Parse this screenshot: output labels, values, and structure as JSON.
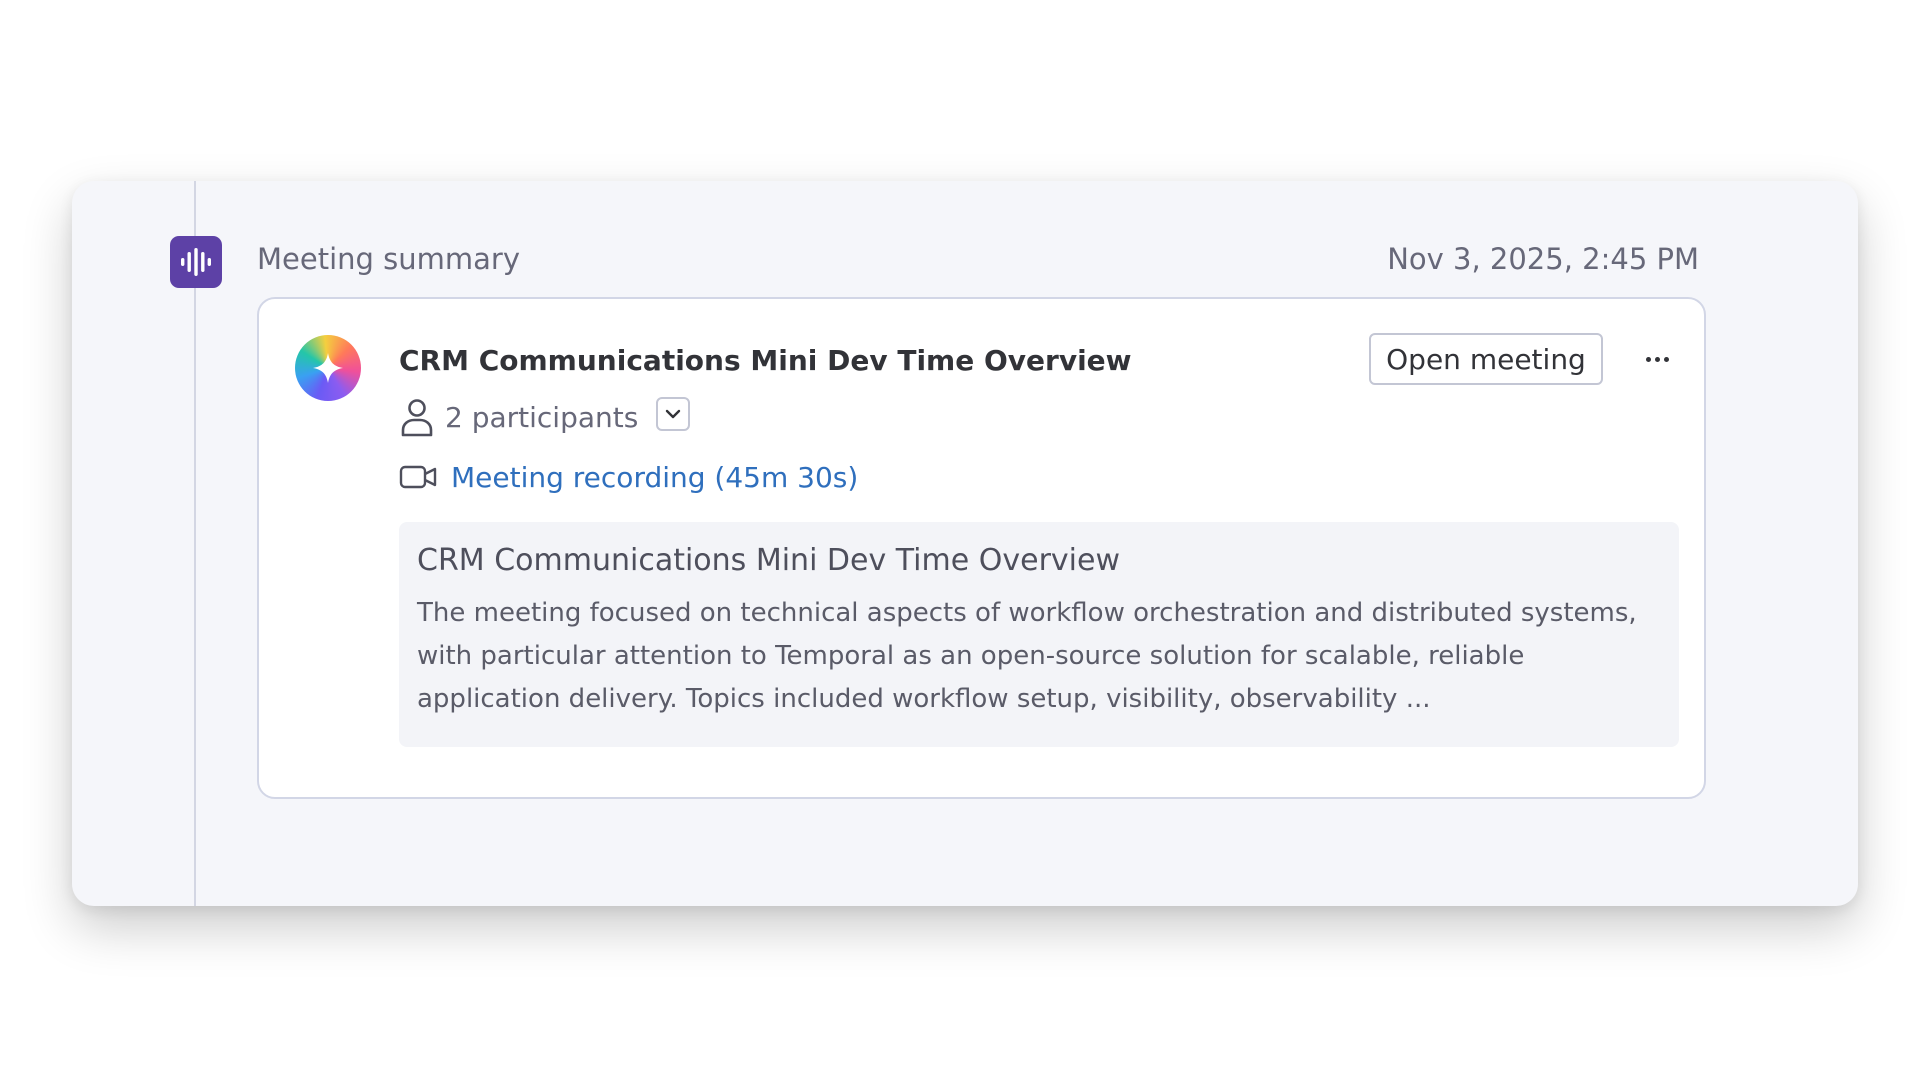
{
  "header": {
    "icon": "audio-waveform-icon",
    "title": "Meeting summary",
    "datetime": "Nov 3, 2025, 2:45 PM",
    "accent_color": "#5d41a6"
  },
  "card": {
    "avatar_icon": "ai-sparkle-icon",
    "title": "CRM Communications Mini Dev Time Overview",
    "open_button_label": "Open meeting",
    "more_icon": "more-horizontal-icon",
    "participants": {
      "icon": "person-icon",
      "label": "2 participants",
      "toggle_icon": "chevron-down-icon"
    },
    "recording": {
      "icon": "video-camera-icon",
      "label": "Meeting recording (45m 30s)",
      "link_color": "#2f6fbd"
    },
    "summary": {
      "title": "CRM Communications Mini Dev Time Overview",
      "text": "The meeting focused on technical aspects of workflow orchestration and distributed systems, with particular attention to Temporal as an open-source solution for scalable, reliable application delivery. Topics included workflow setup, visibility, observability ..."
    }
  }
}
